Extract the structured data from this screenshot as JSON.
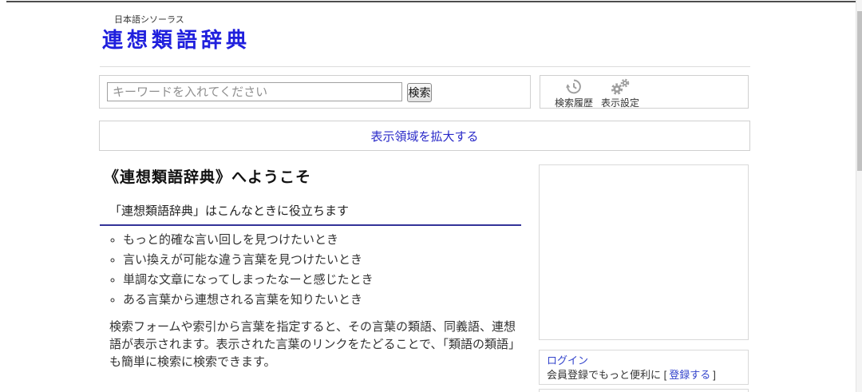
{
  "header": {
    "tagline": "日本語シソーラス",
    "title": "連想類語辞典"
  },
  "search": {
    "input_placeholder": "キーワードを入れてください",
    "search_button": "検索",
    "history_button": "検索履歴",
    "settings_button": "表示設定"
  },
  "toolbar": {
    "expand_link": "表示領域を拡大する"
  },
  "main": {
    "welcome_heading": "《連想類語辞典》へようこそ",
    "section_heading": "「連想類語辞典」はこんなときに役立ちます",
    "use_cases": [
      "もっと的確な言い回しを見つけたいとき",
      "言い換えが可能な違う言葉を見つけたいとき",
      "単調な文章になってしまったなーと感じたとき",
      "ある言葉から連想される言葉を知りたいとき"
    ],
    "description": "検索フォームや索引から言葉を指定すると、その言葉の類語、同義語、連想語が表示されます。表示された言葉のリンクをたどることで、「類語の類語」も簡単に検索に検索できます。"
  },
  "sidebar": {
    "login_link": "ログイン",
    "register_prefix": "会員登録でもっと便利に [",
    "register_link": "登録する",
    "register_suffix": "]"
  },
  "colors": {
    "title_blue": "#2020dd",
    "link_blue": "#2a2ac8",
    "sidebar_link_blue": "#3344cc",
    "heading_underline_navy": "#333399",
    "icon_gray": "#9e9e9e",
    "border_gray": "#d0d0d0",
    "text_dark": "#333333"
  }
}
